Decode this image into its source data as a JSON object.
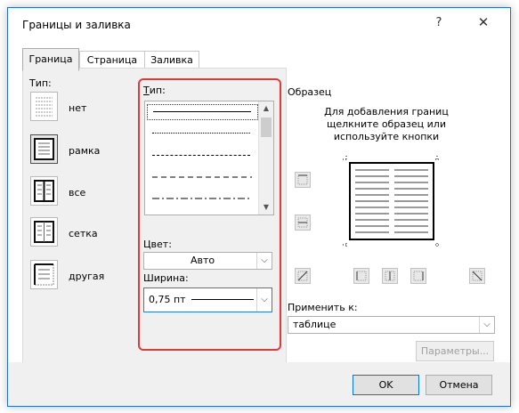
{
  "window": {
    "title": "Границы и заливка",
    "help": "?",
    "close": "✕"
  },
  "tabs": [
    {
      "label": "Граница",
      "active": true
    },
    {
      "label": "Страница",
      "active": false
    },
    {
      "label": "Заливка",
      "active": false
    }
  ],
  "type_section": {
    "header": "Тип:",
    "items": [
      {
        "label": "нет",
        "icon": "border-none-icon"
      },
      {
        "label": "рамка",
        "icon": "border-box-icon",
        "selected": true
      },
      {
        "label": "все",
        "icon": "border-all-icon"
      },
      {
        "label": "сетка",
        "icon": "border-grid-icon"
      },
      {
        "label": "другая",
        "icon": "border-custom-icon"
      }
    ]
  },
  "style_section": {
    "header": "Тип:",
    "color_label": "Цвет:",
    "color_value": "Авто",
    "width_label": "Ширина:",
    "width_value": "0,75 пт"
  },
  "preview": {
    "header": "Образец",
    "hint_line1": "Для добавления границ",
    "hint_line2": "щелкните образец или",
    "hint_line3": "используйте кнопки"
  },
  "apply_to": {
    "label": "Применить к:",
    "value": "таблице",
    "options_button": "Параметры..."
  },
  "footer": {
    "ok": "OK",
    "cancel": "Отмена"
  },
  "colors": {
    "accent": "#0078d7",
    "highlight": "#e03a3a"
  }
}
